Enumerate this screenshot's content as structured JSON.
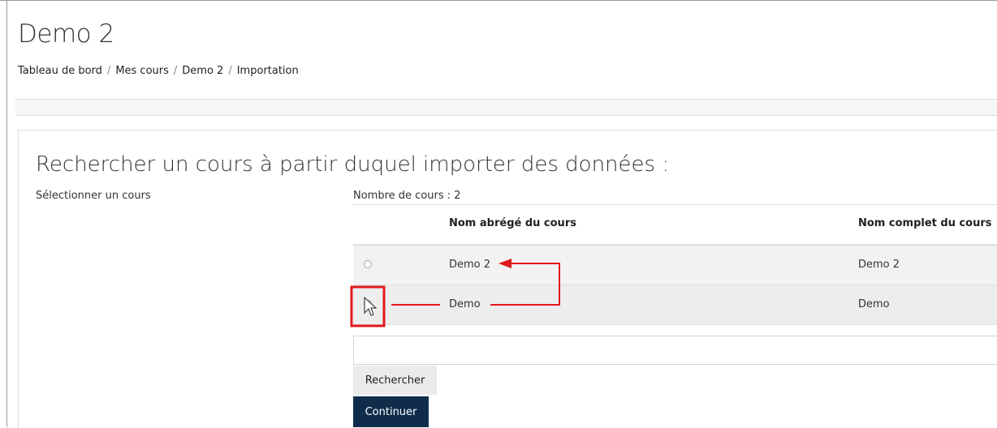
{
  "page": {
    "title": "Demo 2"
  },
  "breadcrumb": [
    "Tableau de bord",
    "Mes cours",
    "Demo 2",
    "Importation"
  ],
  "search_section": {
    "heading": "Rechercher un cours à partir duquel importer des données :",
    "select_label": "Sélectionner un cours",
    "count_text": "Nombre de cours : 2",
    "columns": [
      "Nom abrégé du cours",
      "Nom complet du cours"
    ],
    "rows": [
      {
        "short": "Demo 2",
        "full": "Demo 2",
        "selected": false
      },
      {
        "short": "Demo",
        "full": "Demo",
        "selected": false
      }
    ],
    "search_input_value": "",
    "search_button": "Rechercher",
    "continue_button": "Continuer"
  },
  "colors": {
    "primary_button": "#0f2c4b",
    "annotation": "#e0191d"
  }
}
